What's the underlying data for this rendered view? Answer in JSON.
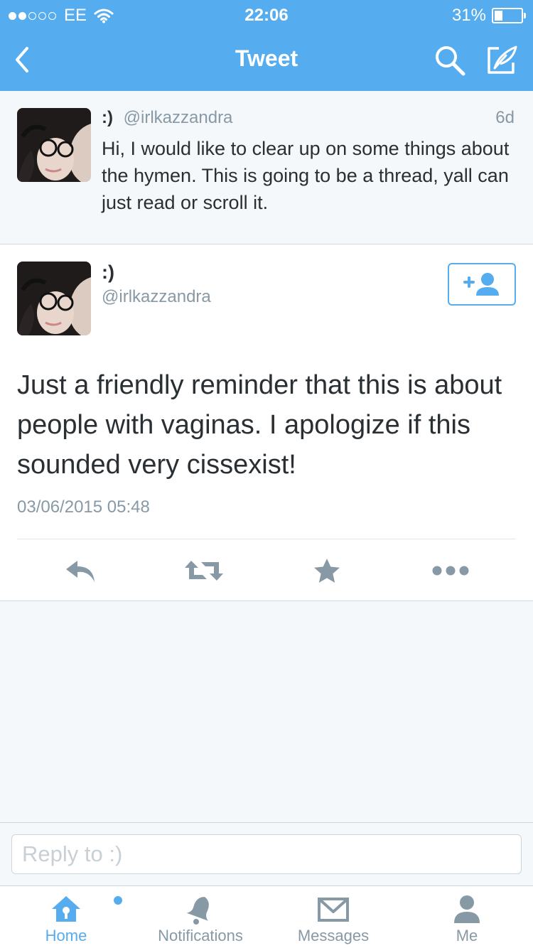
{
  "status_bar": {
    "carrier": "EE",
    "time": "22:06",
    "battery": "31%",
    "battery_level": 0.31,
    "signal_bars": 2,
    "signal_total": 5
  },
  "nav": {
    "title": "Tweet",
    "back_icon": "chevron-left-icon",
    "search_icon": "search-icon",
    "compose_icon": "compose-icon"
  },
  "parent_tweet": {
    "name": ":)",
    "handle": "@irlkazzandra",
    "age": "6d",
    "text": "Hi, I would like to clear up on some things about the hymen. This is going to be a thread, yall can just read or scroll it."
  },
  "tweet": {
    "name": ":)",
    "handle": "@irlkazzandra",
    "body": "Just a friendly reminder that this is about people with vaginas. I apologize if this sounded very cissexist!",
    "timestamp": "03/06/2015 05:48",
    "follow_icon": "follow-plus-user-icon",
    "actions": [
      "reply-icon",
      "retweet-icon",
      "favorite-star-icon",
      "more-dots-icon"
    ]
  },
  "composer": {
    "placeholder": "Reply to :)"
  },
  "tabs": [
    {
      "label": "Home",
      "icon": "home-icon",
      "active": true
    },
    {
      "label": "Notifications",
      "icon": "bell-icon",
      "active": false
    },
    {
      "label": "Messages",
      "icon": "envelope-icon",
      "active": false
    },
    {
      "label": "Me",
      "icon": "person-icon",
      "active": false
    }
  ],
  "colors": {
    "brand": "#55acee",
    "text": "#292f33",
    "muted": "#8899a6",
    "background": "#f5f8fa",
    "icon_gray": "#8899a6"
  }
}
